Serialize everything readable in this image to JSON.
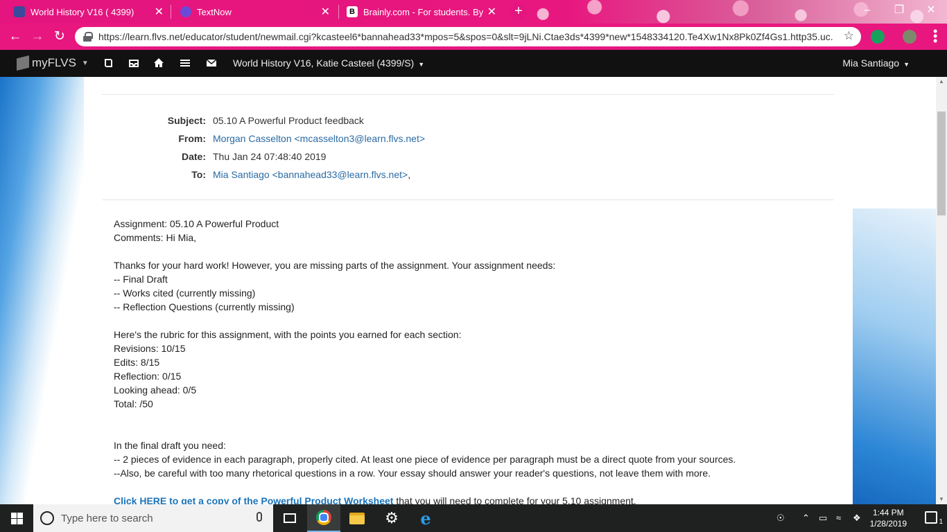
{
  "browser": {
    "tabs": [
      {
        "title": "World History V16 ( 4399)",
        "close": "✕",
        "favicon": "flvs-icon"
      },
      {
        "title": "TextNow",
        "close": "✕",
        "favicon": "textnow-icon"
      },
      {
        "title": "Brainly.com - For students. By stu",
        "close": "✕",
        "favicon": "brainly-icon",
        "favicon_letter": "B"
      }
    ],
    "new_tab": "+",
    "url": "https://learn.flvs.net/educator/student/newmail.cgi?kcasteel6*bannahead33*mpos=5&spos=0&slt=9jLNi.Ctae3ds*4399*new*1548334120.Te4Xw1Nx8Pk0Zf4Gs1.http35.uc...",
    "accent": "#e4157e"
  },
  "flvs": {
    "logo": "myFLVS",
    "course": "World History V16, Katie Casteel (4399/S)",
    "user": "Mia Santiago"
  },
  "email": {
    "subject_label": "Subject:",
    "subject": "05.10 A Powerful Product feedback",
    "from_label": "From:",
    "from": "Morgan Casselton <mcasselton3@learn.flvs.net>",
    "date_label": "Date:",
    "date": "Thu Jan 24 07:48:40 2019",
    "to_label": "To:",
    "to": "Mia Santiago <bannahead33@learn.flvs.net>",
    "to_suffix": ",",
    "body": {
      "assignment": "Assignment: 05.10 A Powerful Product",
      "comments": "Comments: Hi Mia,",
      "thanks": "Thanks for your hard work! However, you are missing parts of the assignment. Your assignment needs:",
      "needs": [
        "-- Final Draft",
        "-- Works cited (currently missing)",
        "-- Reflection Questions (currently missing)"
      ],
      "rubric_intro": "Here's the rubric for this assignment, with the points you earned for each section:",
      "rubric": [
        "Revisions: 10/15",
        "Edits: 8/15",
        "Reflection: 0/15",
        "Looking ahead: 0/5",
        "Total: /50"
      ],
      "final_intro": "In the final draft you need:",
      "final_items": [
        "-- 2 pieces of evidence in each paragraph, properly cited. At least one piece of evidence per paragraph must be a direct quote from your sources.",
        "--Also, be careful with too many rhetorical questions in a row. Your essay should answer your reader's questions, not leave them with more."
      ],
      "worksheet_link": "Click HERE to get a copy of the Powerful Product Worksheet",
      "worksheet_suffix": " that you will need to complete for your 5.10 assignment."
    }
  },
  "taskbar": {
    "search_placeholder": "Type here to search",
    "time": "1:44 PM",
    "date": "1/28/2019",
    "notification_count": "1"
  }
}
